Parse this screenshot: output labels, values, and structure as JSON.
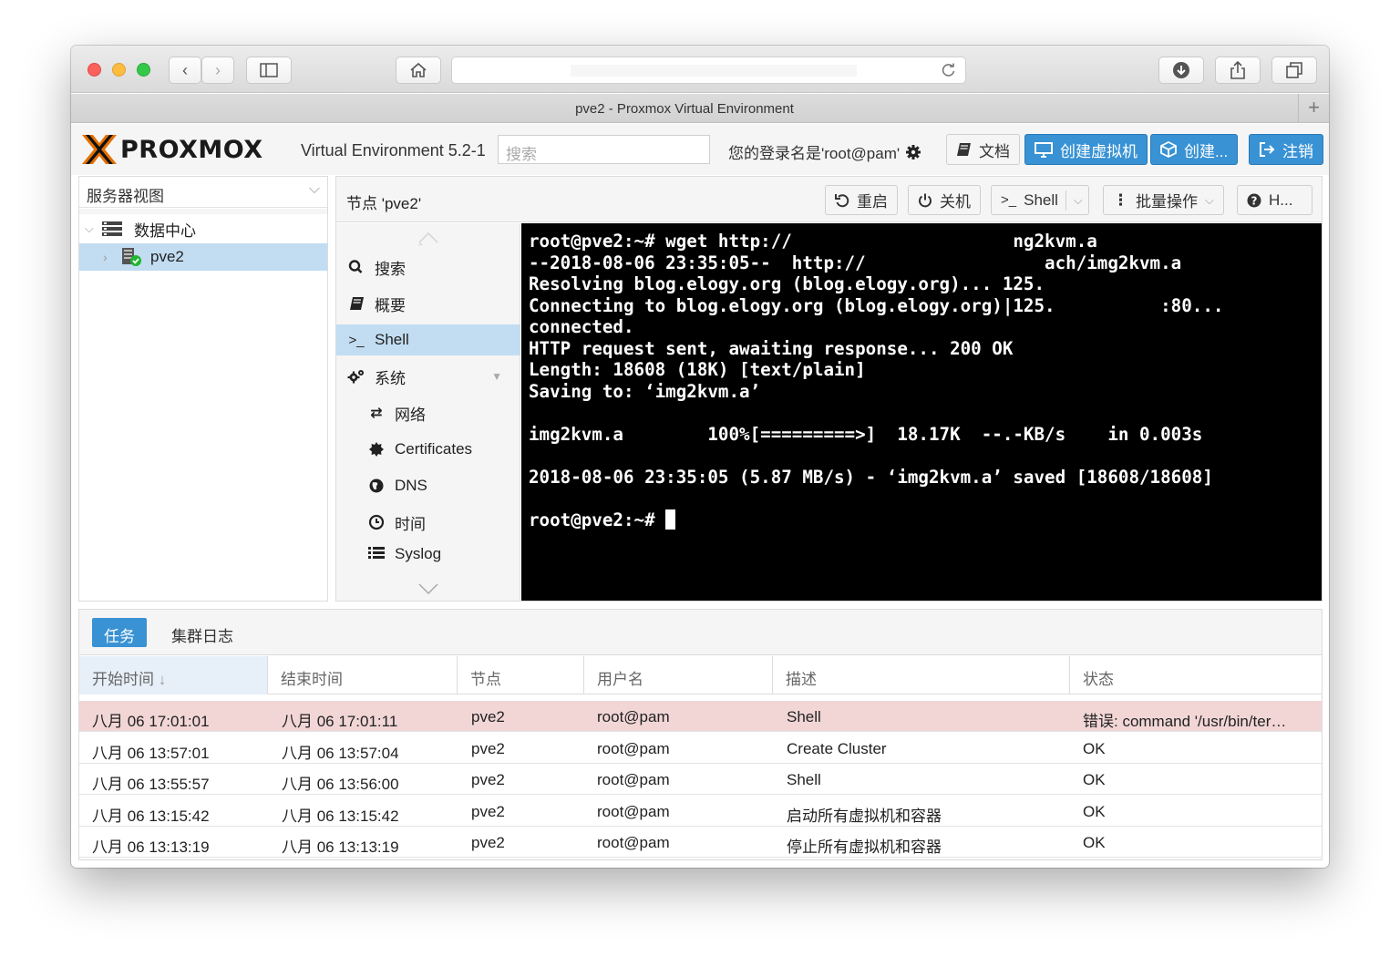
{
  "browser": {
    "tab_title": "pve2 - Proxmox Virtual Environment",
    "new_tab_label": "+"
  },
  "header": {
    "logo_text": "PROXMOX",
    "version": "Virtual Environment 5.2-1",
    "search_placeholder": "搜索",
    "login_text": "您的登录名是'root@pam'",
    "docs_button": "文档",
    "create_vm_button": "创建虚拟机",
    "create_ct_button": "创建...",
    "logout_button": "注销",
    "accent_color": "#3892d4"
  },
  "left_panel": {
    "view_select": "服务器视图",
    "tree": [
      {
        "label": "数据中心",
        "icon": "server-stack-icon"
      },
      {
        "label": "pve2",
        "icon": "node-online-icon"
      }
    ]
  },
  "content": {
    "title": "节点 'pve2'",
    "toolbar": {
      "reboot": "重启",
      "shutdown": "关机",
      "shell": "Shell",
      "bulk": "批量操作",
      "help": "H..."
    },
    "nav": [
      {
        "label": "搜索",
        "icon": "search-icon"
      },
      {
        "label": "概要",
        "icon": "book-icon"
      },
      {
        "label": "Shell",
        "icon": "terminal-icon"
      },
      {
        "label": "系统",
        "icon": "cogs-icon"
      },
      {
        "label": "网络",
        "icon": "exchange-icon"
      },
      {
        "label": "Certificates",
        "icon": "certificate-icon"
      },
      {
        "label": "DNS",
        "icon": "globe-icon"
      },
      {
        "label": "时间",
        "icon": "clock-icon"
      },
      {
        "label": "Syslog",
        "icon": "list-icon"
      }
    ]
  },
  "terminal": {
    "lines": [
      "root@pve2:~# wget http://                     ng2kvm.a",
      "--2018-08-06 23:35:05--  http://                 ach/img2kvm.a",
      "Resolving blog.elogy.org (blog.elogy.org)... 125.",
      "Connecting to blog.elogy.org (blog.elogy.org)|125.          :80...",
      "connected.",
      "HTTP request sent, awaiting response... 200 OK",
      "Length: 18608 (18K) [text/plain]",
      "Saving to: ‘img2kvm.a’",
      "",
      "img2kvm.a        100%[=========>]  18.17K  --.-KB/s    in 0.003s",
      "",
      "2018-08-06 23:35:05 (5.87 MB/s) - ‘img2kvm.a’ saved [18608/18608]",
      "",
      "root@pve2:~# "
    ]
  },
  "bottom": {
    "tabs": [
      "任务",
      "集群日志"
    ],
    "columns": [
      "开始时间",
      "结束时间",
      "节点",
      "用户名",
      "描述",
      "状态"
    ],
    "rows": [
      {
        "start": "八月 06 17:01:01",
        "end": "八月 06 17:01:11",
        "node": "pve2",
        "user": "root@pam",
        "desc": "Shell",
        "status": "错误: command '/usr/bin/ter…"
      },
      {
        "start": "八月 06 13:57:01",
        "end": "八月 06 13:57:04",
        "node": "pve2",
        "user": "root@pam",
        "desc": "Create Cluster",
        "status": "OK"
      },
      {
        "start": "八月 06 13:55:57",
        "end": "八月 06 13:56:00",
        "node": "pve2",
        "user": "root@pam",
        "desc": "Shell",
        "status": "OK"
      },
      {
        "start": "八月 06 13:15:42",
        "end": "八月 06 13:15:42",
        "node": "pve2",
        "user": "root@pam",
        "desc": "启动所有虚拟机和容器",
        "status": "OK"
      },
      {
        "start": "八月 06 13:13:19",
        "end": "八月 06 13:13:19",
        "node": "pve2",
        "user": "root@pam",
        "desc": "停止所有虚拟机和容器",
        "status": "OK"
      }
    ]
  }
}
